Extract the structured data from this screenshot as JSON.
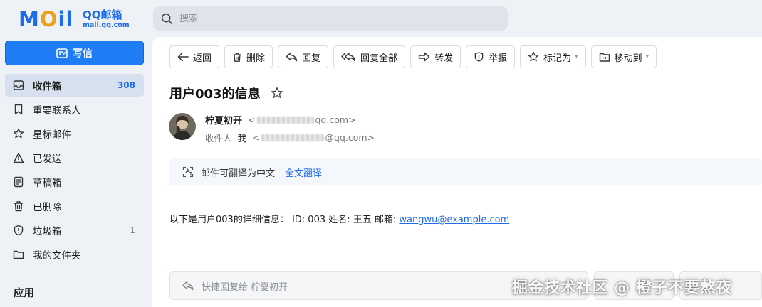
{
  "brand": {
    "logo_text": "MOil",
    "product_name": "QQ邮箱",
    "domain": "mail.qq.com",
    "primary_color": "#1e6de8",
    "accent_color": "#f0a11a"
  },
  "search": {
    "placeholder": "搜索",
    "icon": "search-icon"
  },
  "sidebar": {
    "compose_label": "写信",
    "items": [
      {
        "label": "收件箱",
        "count": "308",
        "icon": "inbox-icon",
        "active": true
      },
      {
        "label": "重要联系人",
        "count": "",
        "icon": "bookmark-icon"
      },
      {
        "label": "星标邮件",
        "count": "",
        "icon": "star-icon"
      },
      {
        "label": "已发送",
        "count": "",
        "icon": "send-icon"
      },
      {
        "label": "草稿箱",
        "count": "",
        "icon": "draft-icon"
      },
      {
        "label": "已删除",
        "count": "",
        "icon": "trash-icon"
      },
      {
        "label": "垃圾箱",
        "count": "1",
        "icon": "shield-icon"
      },
      {
        "label": "我的文件夹",
        "count": "",
        "icon": "folder-icon"
      }
    ],
    "apps_title": "应用"
  },
  "toolbar": {
    "back": "返回",
    "delete": "删除",
    "reply": "回复",
    "reply_all": "回复全部",
    "forward": "转发",
    "report": "举报",
    "mark_as": "标记为",
    "move_to": "移动到"
  },
  "message": {
    "subject": "用户003的信息",
    "sender_name": "柠夏初开",
    "sender_domain": "qq.com>",
    "recipient_label": "收件人",
    "recipient_me": "我",
    "recipient_domain": "@qq.com>",
    "translate_text": "邮件可翻译为中文",
    "translate_link": "全文翻译",
    "body_prefix": "以下是用户003的详细信息：  ID: 003 姓名: 王五 邮箱: ",
    "body_email": "wangwu@example.com"
  },
  "quick_reply": {
    "placeholder": "快捷回复给 柠夏初开"
  },
  "watermark": "掘金技术社区 @ 橙子不要熬夜"
}
